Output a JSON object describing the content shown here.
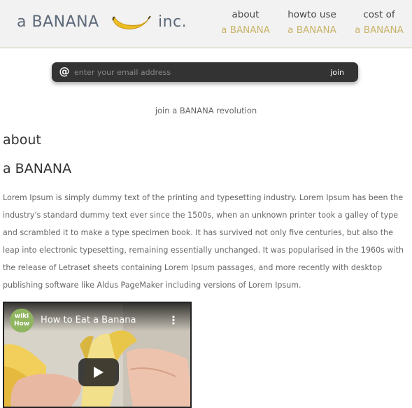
{
  "brand": {
    "name": "a BANANA",
    "suffix": "inc."
  },
  "nav": [
    {
      "line1": "about",
      "line2": "a BANANA"
    },
    {
      "line1": "howto use",
      "line2": "a BANANA"
    },
    {
      "line1": "cost of",
      "line2": "a BANANA"
    }
  ],
  "signup": {
    "placeholder": "enter your email address",
    "value": "",
    "button_label": "join",
    "icon": "at-icon"
  },
  "tagline": "join a BANANA revolution",
  "about": {
    "title_line1": "about",
    "title_line2": "a BANANA",
    "body": "Lorem Ipsum is simply dummy text of the printing and typesetting industry. Lorem Ipsum has been the industry's standard dummy text ever since the 1500s, when an unknown printer took a galley of type and scrambled it to make a type specimen book. It has survived not only five centuries, but also the leap into electronic typesetting, remaining essentially unchanged. It was popularised in the 1960s with the release of Letraset sheets containing Lorem Ipsum passages, and more recently with desktop publishing software like Aldus PageMaker including versions of Lorem Ipsum."
  },
  "video": {
    "channel_badge": "wiki How",
    "title": "How to Eat a Banana",
    "menu_icon": "more-vert-icon",
    "play_icon": "play-icon"
  },
  "colors": {
    "header_bg": "#f2f2f2",
    "brand_text": "#5e6a7a",
    "nav_accent": "#c8b46a",
    "email_bar_bg": "#333333",
    "body_text": "#666666"
  }
}
